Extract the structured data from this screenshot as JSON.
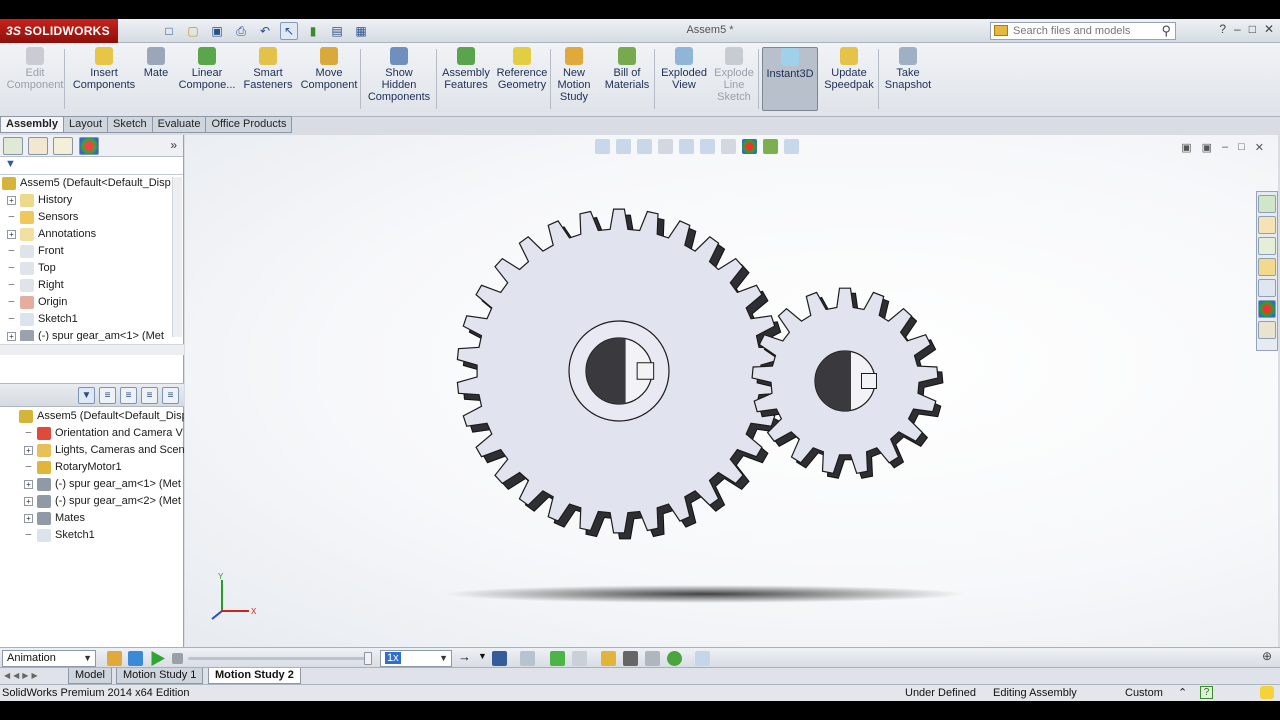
{
  "app": {
    "brand": "SOLIDWORKS",
    "brand_prefix": "3S",
    "document_title": "Assem5 *",
    "search_placeholder": "Search files and models",
    "help_icon": "help-icon",
    "window_controls": [
      "–",
      "□",
      "✕"
    ]
  },
  "command_manager": {
    "buttons": [
      {
        "label": "Edit\nComponent",
        "icon": "edit-component-icon",
        "enabled": false
      },
      {
        "label": "Insert\nComponents",
        "icon": "insert-components-icon",
        "enabled": true
      },
      {
        "label": "Mate",
        "icon": "mate-icon",
        "enabled": true
      },
      {
        "label": "Linear\nCompone...",
        "icon": "linear-pattern-icon",
        "enabled": true
      },
      {
        "label": "Smart\nFasteners",
        "icon": "smart-fasteners-icon",
        "enabled": true
      },
      {
        "label": "Move\nComponent",
        "icon": "move-component-icon",
        "enabled": true
      },
      {
        "label": "Show\nHidden\nComponents",
        "icon": "show-hidden-icon",
        "enabled": true
      },
      {
        "label": "Assembly\nFeatures",
        "icon": "assembly-features-icon",
        "enabled": true
      },
      {
        "label": "Reference\nGeometry",
        "icon": "reference-geometry-icon",
        "enabled": true
      },
      {
        "label": "New\nMotion\nStudy",
        "icon": "motion-study-icon",
        "enabled": true
      },
      {
        "label": "Bill of\nMaterials",
        "icon": "bill-of-materials-icon",
        "enabled": true
      },
      {
        "label": "Exploded\nView",
        "icon": "exploded-view-icon",
        "enabled": true
      },
      {
        "label": "Explode\nLine\nSketch",
        "icon": "explode-line-icon",
        "enabled": false
      },
      {
        "label": "Instant3D",
        "icon": "instant3d-icon",
        "enabled": true,
        "selected": true
      },
      {
        "label": "Update\nSpeedpak",
        "icon": "speedpak-icon",
        "enabled": true
      },
      {
        "label": "Take\nSnapshot",
        "icon": "snapshot-icon",
        "enabled": true
      }
    ]
  },
  "tabs": [
    "Assembly",
    "Layout",
    "Sketch",
    "Evaluate",
    "Office Products"
  ],
  "feature_tree": {
    "root": "Assem5  (Default<Default_Disp",
    "items": [
      {
        "label": "History",
        "expand": "+"
      },
      {
        "label": "Sensors",
        "expand": ""
      },
      {
        "label": "Annotations",
        "expand": "+"
      },
      {
        "label": "Front",
        "expand": ""
      },
      {
        "label": "Top",
        "expand": ""
      },
      {
        "label": "Right",
        "expand": ""
      },
      {
        "label": "Origin",
        "expand": ""
      },
      {
        "label": "Sketch1",
        "expand": ""
      },
      {
        "label": "(-) spur gear_am<1> (Met",
        "expand": "+"
      }
    ]
  },
  "motion_tree": {
    "root": "Assem5  (Default<Default_Disp",
    "items": [
      {
        "label": "Orientation and Camera V",
        "expand": ""
      },
      {
        "label": "Lights, Cameras and Scen",
        "expand": "+"
      },
      {
        "label": "RotaryMotor1",
        "expand": ""
      },
      {
        "label": "(-) spur gear_am<1> (Met",
        "expand": "+"
      },
      {
        "label": "(-) spur gear_am<2> (Met",
        "expand": "+"
      },
      {
        "label": "Mates",
        "expand": "+"
      },
      {
        "label": "Sketch1",
        "expand": ""
      }
    ]
  },
  "motion_toolbar": {
    "study_type": "Animation",
    "playback_speed": "1x"
  },
  "bottom_tabs": [
    "Model",
    "Motion Study 1",
    "Motion Study 2"
  ],
  "active_bottom_tab": "Motion Study 2",
  "status_bar": {
    "edition": "SolidWorks Premium 2014 x64 Edition",
    "definition": "Under Defined",
    "mode": "Editing Assembly",
    "units": "Custom",
    "units_marker": "⌃"
  },
  "triad": {
    "y": "Y",
    "x": "X"
  },
  "colors": {
    "gear_face": "#e1e3ef",
    "gear_dark": "#2f2f33",
    "brand_red": "#b81c16",
    "selection_blue": "#dfe9f6"
  }
}
